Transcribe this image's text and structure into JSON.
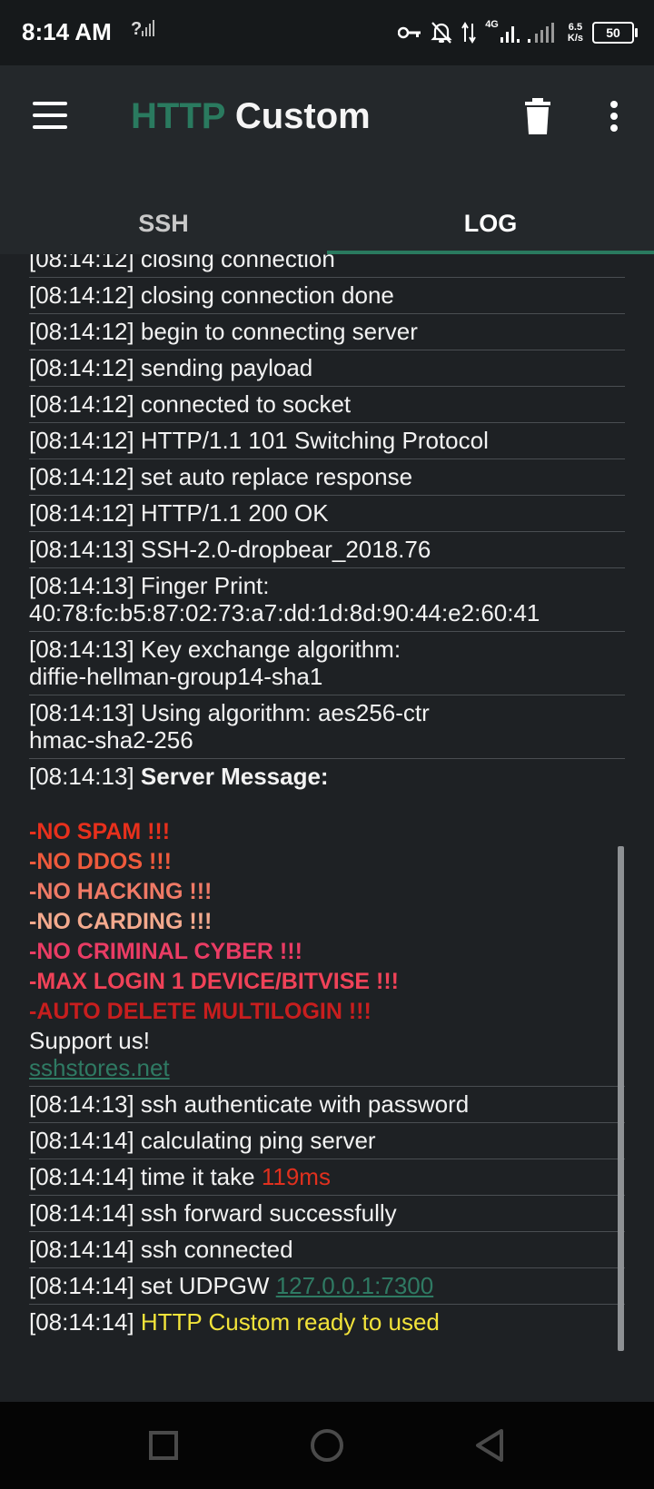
{
  "status_bar": {
    "time": "8:14 AM",
    "net_unknown": "?",
    "network_type": "4G",
    "speed_value": "6.5",
    "speed_unit": "K/s",
    "battery": "50",
    "icons": [
      "signal-unknown-icon",
      "vpn-key-icon",
      "notifications-off-icon",
      "data-transfer-icon",
      "signal-4g-icon",
      "signal-icon",
      "battery-icon"
    ]
  },
  "app_bar": {
    "title_part1": "HTTP",
    "title_part2": "Custom",
    "menu_icon": "hamburger-menu-icon",
    "delete_icon": "trash-icon",
    "more_icon": "more-vert-icon",
    "accent_color": "#2a7a5f"
  },
  "tabs": [
    {
      "label": "SSH",
      "active": false
    },
    {
      "label": "LOG",
      "active": true
    }
  ],
  "log": {
    "partial_row": "[08:14:12] closing connection",
    "rows_before": [
      {
        "time": "[08:14:12]",
        "text": "closing connection done"
      },
      {
        "time": "[08:14:12]",
        "text": "begin to connecting server"
      },
      {
        "time": "[08:14:12]",
        "text": "sending payload"
      },
      {
        "time": "[08:14:12]",
        "text": "connected to socket"
      },
      {
        "time": "[08:14:12]",
        "text": "HTTP/1.1 101 Switching Protocol"
      },
      {
        "time": "[08:14:12]",
        "text": "set auto replace response"
      },
      {
        "time": "[08:14:12]",
        "text": "HTTP/1.1 200 OK"
      },
      {
        "time": "[08:14:13]",
        "text": "SSH-2.0-dropbear_2018.76"
      },
      {
        "time": "[08:14:13]",
        "text": "Finger Print:\n40:78:fc:b5:87:02:73:a7:dd:1d:8d:90:44:e2:60:41"
      },
      {
        "time": "[08:14:13]",
        "text": "Key exchange algorithm:\ndiffie-hellman-group14-sha1"
      },
      {
        "time": "[08:14:13]",
        "text": "Using algorithm: aes256-ctr\nhmac-sha2-256"
      }
    ],
    "server_message": {
      "time": "[08:14:13]",
      "label": "Server Message:",
      "lines": [
        {
          "text": "-NO SPAM !!!",
          "color": "#e8301c"
        },
        {
          "text": "-NO DDOS !!!",
          "color": "#ef5a3c"
        },
        {
          "text": "-NO HACKING !!!",
          "color": "#f07a66"
        },
        {
          "text": "-NO CARDING !!!",
          "color": "#f4aa8e"
        },
        {
          "text": "-NO CRIMINAL CYBER !!!",
          "color": "#ea3c64"
        },
        {
          "text": "-MAX LOGIN 1 DEVICE/BITVISE !!!",
          "color": "#f04258"
        },
        {
          "text": "-AUTO DELETE MULTILOGIN !!!",
          "color": "#c81e1e"
        }
      ],
      "support": "Support us!",
      "link": "sshstores.net"
    },
    "rows_after": [
      {
        "time": "[08:14:13]",
        "text": "ssh authenticate with password"
      },
      {
        "time": "[08:14:14]",
        "text": "calculating ping server"
      }
    ],
    "ping_row": {
      "time": "[08:14:14]",
      "text": "time it take",
      "value": "119ms"
    },
    "rows_after2": [
      {
        "time": "[08:14:14]",
        "text": "ssh forward successfully"
      },
      {
        "time": "[08:14:14]",
        "text": "ssh connected"
      }
    ],
    "udpgw_row": {
      "time": "[08:14:14]",
      "text": "set UDPGW",
      "value": "127.0.0.1:7300"
    },
    "ready_row": {
      "time": "[08:14:14]",
      "text": "HTTP Custom ready to used",
      "color": "#f2e33a"
    }
  },
  "nav_bar": {
    "icons": [
      "recents-square-icon",
      "home-circle-icon",
      "back-triangle-icon"
    ]
  }
}
